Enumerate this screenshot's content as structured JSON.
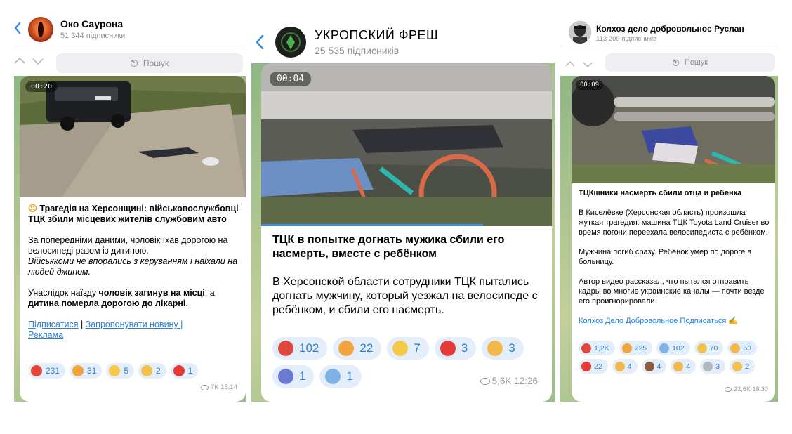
{
  "panels": [
    {
      "channel": "Око Саурона",
      "subscribers": "51 344 підписники",
      "search_placeholder": "Пошук",
      "video_duration": "00:20",
      "headline": "Трагедія на Херсонщині: військовослужбовці ТЦК збили місцевих жителів службовим авто",
      "para1": "За попередніми даними, чоловік їхав дорогою на велосипеді разом із дитиною.",
      "para1_italic": "Військкоми не впорались з керуванням і наїхали на людей джипом.",
      "para2_a": "Унаслідок наїзду ",
      "para2_b": "чоловік загинув на місці",
      "para2_c": ", а ",
      "para2_d": "дитина померла дорогою до лікарні",
      "para2_e": ".",
      "link1": "Підписатися",
      "link_sep": " | ",
      "link2": "Запропонувати новину |",
      "link3": "Реклама",
      "reactions": [
        {
          "emoji": "angry-face",
          "color": "#e0483e",
          "count": "231"
        },
        {
          "emoji": "exploding-head",
          "color": "#f2a53b",
          "count": "31"
        },
        {
          "emoji": "grinning-face",
          "color": "#f7c948",
          "count": "5"
        },
        {
          "emoji": "crying-face",
          "color": "#f2c14e",
          "count": "2"
        },
        {
          "emoji": "red-heart",
          "color": "#e53935",
          "count": "1"
        }
      ],
      "views": "7K",
      "time": "15:14"
    },
    {
      "channel": "УКРОПСКИЙ ФРЕШ",
      "subscribers": "25 535 підписників",
      "video_duration": "00:04",
      "headline": "ТЦК в попытке догнать мужика сбили его насмерть, вместе с ребёнком",
      "body": "В Херсонской области сотрудники ТЦК пытались догнать мужчину, который уезжал на велосипеде с ребёнком, и сбили его насмерть.",
      "reactions": [
        {
          "emoji": "angry-face",
          "color": "#e0483e",
          "count": "102"
        },
        {
          "emoji": "exploding-head",
          "color": "#f2a53b",
          "count": "22"
        },
        {
          "emoji": "grinning-face",
          "color": "#f7c948",
          "count": "7"
        },
        {
          "emoji": "red-heart",
          "color": "#e53935",
          "count": "3"
        },
        {
          "emoji": "thumbs-up",
          "color": "#f2b84b",
          "count": "3"
        },
        {
          "emoji": "shrugging-person",
          "color": "#6a7bd6",
          "count": "1"
        },
        {
          "emoji": "screaming-face",
          "color": "#7fb3e6",
          "count": "1"
        }
      ],
      "views": "5,6K",
      "time": "12:26"
    },
    {
      "channel": "Колхоз дело добровольное Руслан",
      "subscribers": "113 209 підписників",
      "search_placeholder": "Пошук",
      "video_duration": "00:09",
      "headline": "ТЦКшники насмерть сбили отца и ребенка",
      "para1": "В Киселёвке (Херсонская область) произошла жуткая трагедия: машина ТЦК Toyota Land Cruiser во время погони переехала велосипедиста с ребёнком.",
      "para2": "Мужчина погиб сразу. Ребёнок умер по дороге в больницу.",
      "para3": "Автор видео рассказал, что пытался отправить кадры во многие украинские каналы — почти везде его проигнорировали.",
      "link": "Колхоз Дело Добровольное Подписаться",
      "link_emoji": "✍",
      "reactions": [
        {
          "emoji": "angry-face",
          "color": "#e0483e",
          "count": "1,2K"
        },
        {
          "emoji": "exploding-head",
          "color": "#f2a53b",
          "count": "225"
        },
        {
          "emoji": "screaming-face",
          "color": "#7fb3e6",
          "count": "102"
        },
        {
          "emoji": "crying-face",
          "color": "#f2c14e",
          "count": "70"
        },
        {
          "emoji": "folded-hands",
          "color": "#f2b84b",
          "count": "53"
        },
        {
          "emoji": "red-heart",
          "color": "#e53935",
          "count": "22"
        },
        {
          "emoji": "thumbs-up",
          "color": "#f2b84b",
          "count": "4"
        },
        {
          "emoji": "pile-of-poo",
          "color": "#8d5a3b",
          "count": "4"
        },
        {
          "emoji": "victory-hand",
          "color": "#f2b84b",
          "count": "4"
        },
        {
          "emoji": "dove",
          "color": "#b0b8c4",
          "count": "3"
        },
        {
          "emoji": "thinking-face",
          "color": "#f2c14e",
          "count": "2"
        }
      ],
      "views": "22,6K",
      "time": "18:30"
    }
  ]
}
